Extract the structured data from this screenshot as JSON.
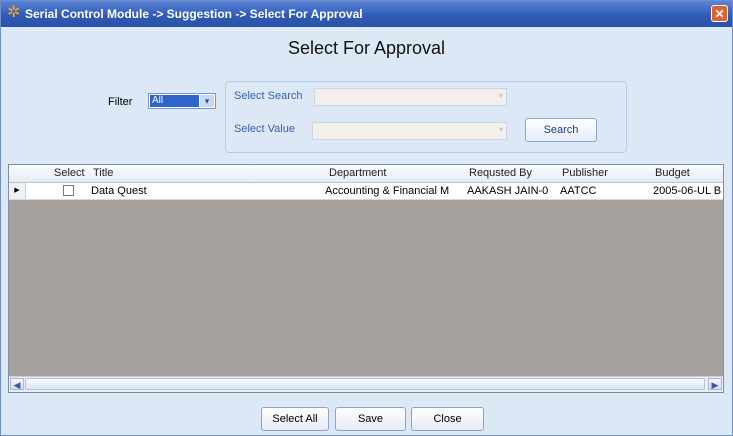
{
  "window": {
    "title": "Serial Control Module -> Suggestion -> Select For Approval",
    "close_glyph": "✕"
  },
  "page": {
    "heading": "Select For Approval"
  },
  "filter": {
    "label": "Filter",
    "selected": "All",
    "arrow_glyph": "▾"
  },
  "search_group": {
    "select_search_label": "Select Search",
    "select_value_label": "Select Value",
    "search_button": "Search",
    "arrow_glyph": "▾"
  },
  "grid": {
    "columns": [
      "Select",
      "Title",
      "Department",
      "Requsted By",
      "Publisher",
      "Budget"
    ],
    "rows": [
      {
        "selected": false,
        "title": "Data Quest",
        "department": "Accounting & Financial M",
        "requested_by": "AAKASH JAIN-0",
        "publisher": "AATCC",
        "budget": "2005-06-UL B"
      }
    ],
    "row_indicator": "▶",
    "scroll_left": "◀",
    "scroll_right": "▶"
  },
  "buttons": {
    "select_all": "Select All",
    "save": "Save",
    "close": "Close"
  },
  "colors": {
    "titlebar": "#2f5bb8",
    "window_bg": "#dde8f7",
    "grid_empty_bg": "#a6a09d",
    "close_button": "#e06030"
  },
  "icons": {
    "app": "sparkle-icon",
    "close": "close-icon"
  }
}
